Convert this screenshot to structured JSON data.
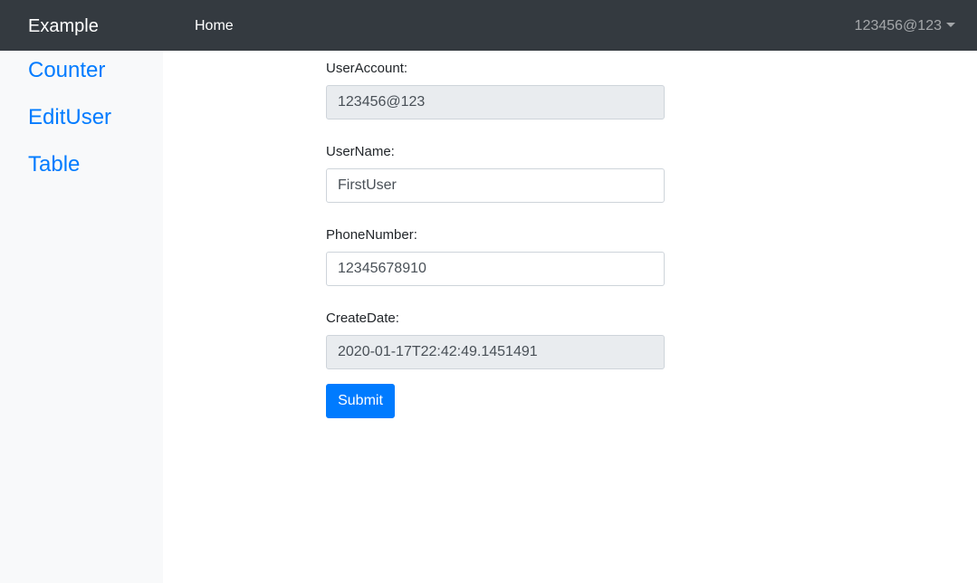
{
  "navbar": {
    "brand": "Example",
    "home_label": "Home",
    "user_label": "123456@123"
  },
  "sidebar": {
    "items": [
      {
        "label": "Counter"
      },
      {
        "label": "EditUser"
      },
      {
        "label": "Table"
      }
    ]
  },
  "form": {
    "user_account": {
      "label": "UserAccount:",
      "value": "123456@123"
    },
    "user_name": {
      "label": "UserName:",
      "value": "FirstUser"
    },
    "phone_number": {
      "label": "PhoneNumber:",
      "value": "12345678910"
    },
    "create_date": {
      "label": "CreateDate:",
      "value": "2020-01-17T22:42:49.1451491"
    },
    "submit_label": "Submit"
  },
  "colors": {
    "navbar_bg": "#343a40",
    "sidebar_bg": "#f8f9fa",
    "link": "#007bff",
    "primary_button": "#007bff",
    "readonly_bg": "#e9ecef"
  },
  "icons": {
    "user_menu_caret": "caret-down-icon"
  }
}
